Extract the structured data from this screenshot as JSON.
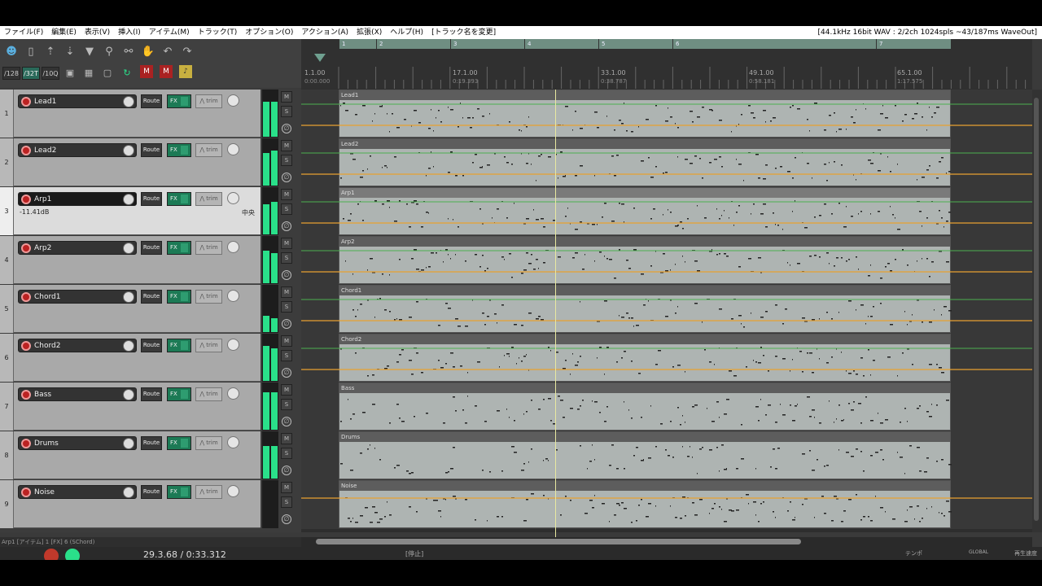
{
  "menubar": {
    "items": [
      "ファイル(F)",
      "編集(E)",
      "表示(V)",
      "挿入(I)",
      "アイテム(M)",
      "トラック(T)",
      "オプション(O)",
      "アクション(A)",
      "拡張(X)",
      "ヘルプ(H)",
      "[トラック名を変更]"
    ],
    "status": "[44.1kHz 16bit WAV : 2/2ch 1024spls ~43/187ms WaveOut]"
  },
  "toolbar": {
    "grid_options": [
      "/128",
      "/32T",
      "/10Q"
    ],
    "icons": [
      "app-logo-icon",
      "new-project-icon",
      "open-project-icon",
      "save-project-icon",
      "filter-icon",
      "ripple-edit-icon",
      "ripple-all-icon",
      "grab-hand-icon",
      "undo-icon",
      "redo-icon"
    ],
    "record_labels": [
      "M",
      "M"
    ]
  },
  "ruler": {
    "markers": [
      "1",
      "2",
      "3",
      "4",
      "5",
      "6",
      "7"
    ],
    "labels": [
      {
        "bar": "1.1.00",
        "time": "0:00.000"
      },
      {
        "bar": "17.1.00",
        "time": "0:19.393"
      },
      {
        "bar": "33.1.00",
        "time": "0:38.787"
      },
      {
        "bar": "49.1.00",
        "time": "0:58.181"
      },
      {
        "bar": "65.1.00",
        "time": "1:17.575"
      }
    ]
  },
  "tracks": [
    {
      "num": "1",
      "name": "Lead1",
      "route": "Route",
      "fx": "FX",
      "trim": "trim",
      "mute": "M",
      "solo": "S",
      "phase": "∅"
    },
    {
      "num": "2",
      "name": "Lead2",
      "route": "Route",
      "fx": "FX",
      "trim": "trim",
      "mute": "M",
      "solo": "S",
      "phase": "∅"
    },
    {
      "num": "3",
      "name": "Arp1",
      "route": "Route",
      "fx": "FX",
      "trim": "trim",
      "mute": "M",
      "solo": "S",
      "phase": "∅",
      "volume": "-11.41dB",
      "pan": "中央"
    },
    {
      "num": "4",
      "name": "Arp2",
      "route": "Route",
      "fx": "FX",
      "trim": "trim",
      "mute": "M",
      "solo": "S",
      "phase": "∅"
    },
    {
      "num": "5",
      "name": "Chord1",
      "route": "Route",
      "fx": "FX",
      "trim": "trim",
      "mute": "M",
      "solo": "S",
      "phase": "∅"
    },
    {
      "num": "6",
      "name": "Chord2",
      "route": "Route",
      "fx": "FX",
      "trim": "trim",
      "mute": "M",
      "solo": "S",
      "phase": "∅"
    },
    {
      "num": "7",
      "name": "Bass",
      "route": "Route",
      "fx": "FX",
      "trim": "trim",
      "mute": "M",
      "solo": "S",
      "phase": "∅"
    },
    {
      "num": "8",
      "name": "Drums",
      "route": "Route",
      "fx": "FX",
      "trim": "trim",
      "mute": "M",
      "solo": "S",
      "phase": "∅"
    },
    {
      "num": "9",
      "name": "Noise",
      "route": "Route",
      "fx": "FX",
      "trim": "trim",
      "mute": "M",
      "solo": "S",
      "phase": "∅"
    }
  ],
  "items": [
    "Lead1",
    "Lead2",
    "Arp1",
    "Arp2",
    "Chord1",
    "Chord2",
    "Bass",
    "Drums",
    "Noise"
  ],
  "status_line": "Arp1 [アイテム] 1 [FX] 6 (SChord)",
  "transport": {
    "position": "29.3.68 / 0:33.312",
    "stopped": "[停止]",
    "tempo_label": "テンポ",
    "global_label": "GLOBAL",
    "playrate_label": "再生速度"
  },
  "colors": {
    "accent_green": "#2ae08a",
    "fx_green": "#1c7a55",
    "envelope_orange": "#e8a030",
    "envelope_green": "#4caf50",
    "cursor": "#e8e8a0"
  }
}
